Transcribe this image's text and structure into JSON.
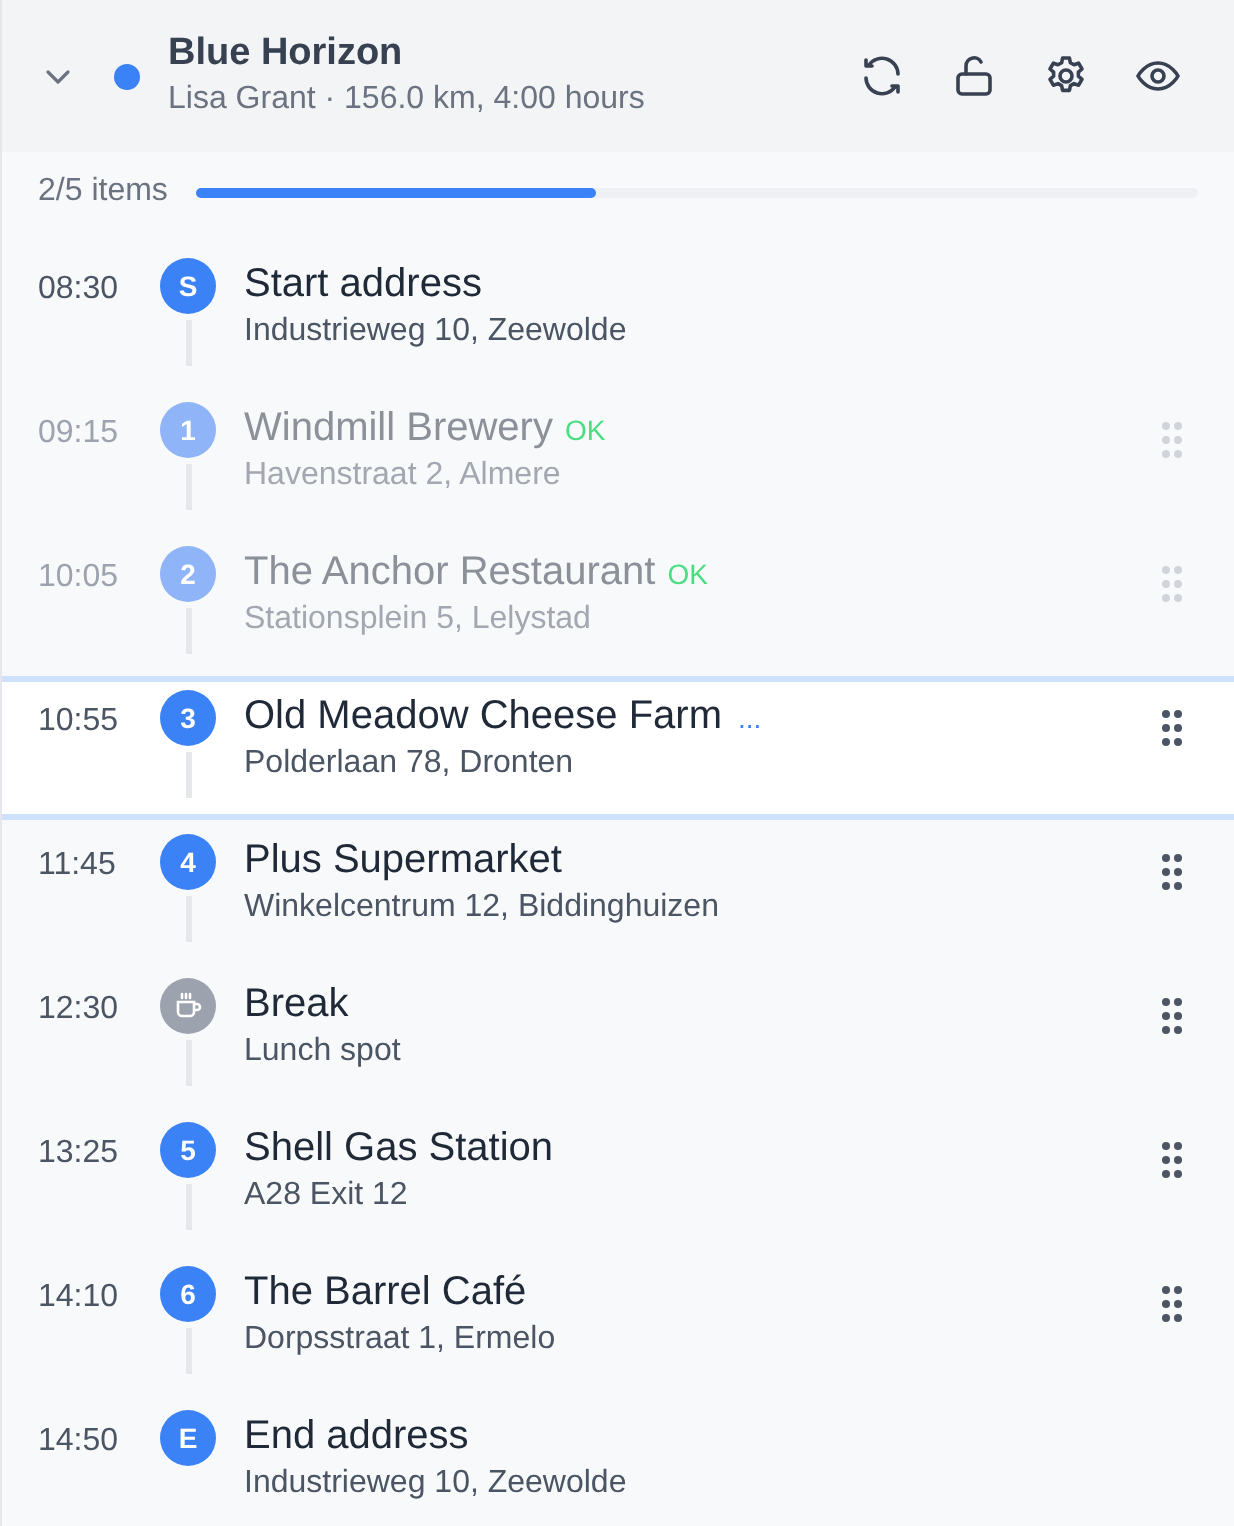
{
  "route": {
    "name": "Blue Horizon",
    "color": "#3b82f6",
    "expanded": true,
    "subtitle": "Lisa Grant · 156.0 km, 4:00 hours"
  },
  "progress": {
    "label": "2/5 items",
    "level": 0.4
  },
  "stops": [
    {
      "kind": "start",
      "time": "08:30",
      "marker": "S",
      "title": "Start address",
      "address": "Industrieweg 10, Zeewolde",
      "done": false,
      "selected": false
    },
    {
      "kind": "stop",
      "time": "09:15",
      "marker": "1",
      "title": "Windmill Brewery",
      "badge": "OK",
      "address": "Havenstraat 2, Almere",
      "done": true,
      "selected": false
    },
    {
      "kind": "stop",
      "time": "10:05",
      "marker": "2",
      "title": "The Anchor Restaurant",
      "badge": "OK",
      "address": "Stationsplein 5, Lelystad",
      "done": true,
      "selected": false
    },
    {
      "kind": "stop",
      "time": "10:55",
      "marker": "3",
      "title": "Old Meadow Cheese Farm",
      "more": "...",
      "address": "Polderlaan 78, Dronten",
      "done": false,
      "selected": true
    },
    {
      "kind": "stop",
      "time": "11:45",
      "marker": "4",
      "title": "Plus Supermarket",
      "address": "Winkelcentrum 12, Biddinghuizen",
      "done": false,
      "selected": false
    },
    {
      "kind": "break",
      "time": "12:30",
      "title": "Break",
      "address": "Lunch spot",
      "done": false,
      "selected": false
    },
    {
      "kind": "stop",
      "time": "13:25",
      "marker": "5",
      "title": "Shell Gas Station",
      "address": "A28 Exit 12",
      "done": false,
      "selected": false
    },
    {
      "kind": "stop",
      "time": "14:10",
      "marker": "6",
      "title": "The Barrel Café",
      "address": "Dorpsstraat 1, Ermelo",
      "done": false,
      "selected": false
    },
    {
      "kind": "end",
      "time": "14:50",
      "marker": "E",
      "title": "End address",
      "address": "Industrieweg 10, Zeewolde",
      "done": false,
      "selected": false
    }
  ]
}
